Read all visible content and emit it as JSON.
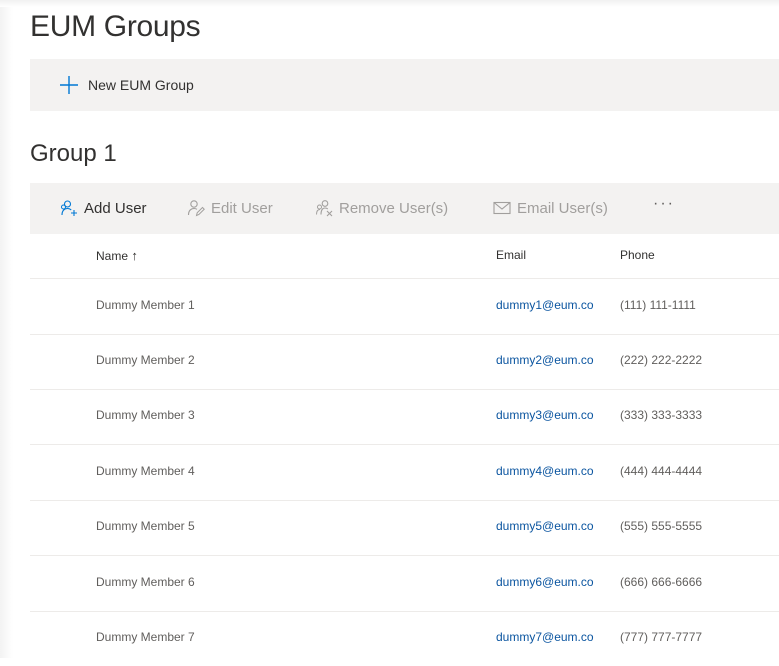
{
  "page": {
    "title": "EUM Groups"
  },
  "command_bar": {
    "new_group_label": "New EUM Group",
    "new_group_icon": "plus-icon"
  },
  "group": {
    "title": "Group 1"
  },
  "toolbar": {
    "add_user": {
      "label": "Add User",
      "icon": "add-friend-icon",
      "enabled": true
    },
    "edit_user": {
      "label": "Edit User",
      "icon": "edit-contact-icon",
      "enabled": false
    },
    "remove_users": {
      "label": "Remove User(s)",
      "icon": "remove-people-icon",
      "enabled": false
    },
    "email_users": {
      "label": "Email User(s)",
      "icon": "mail-icon",
      "enabled": false
    },
    "more": "···"
  },
  "table": {
    "columns": {
      "name": "Name",
      "name_sort_glyph": "↑",
      "email": "Email",
      "phone": "Phone"
    },
    "rows": [
      {
        "name": "Dummy Member 1",
        "email": "dummy1@eum.co",
        "phone": "(111) 111-1111"
      },
      {
        "name": "Dummy Member 2",
        "email": "dummy2@eum.co",
        "phone": "(222) 222-2222"
      },
      {
        "name": "Dummy Member 3",
        "email": "dummy3@eum.co",
        "phone": "(333) 333-3333"
      },
      {
        "name": "Dummy Member 4",
        "email": "dummy4@eum.co",
        "phone": "(444) 444-4444"
      },
      {
        "name": "Dummy Member 5",
        "email": "dummy5@eum.co",
        "phone": "(555) 555-5555"
      },
      {
        "name": "Dummy Member 6",
        "email": "dummy6@eum.co",
        "phone": "(666) 666-6666"
      },
      {
        "name": "Dummy Member 7",
        "email": "dummy7@eum.co",
        "phone": "(777) 777-7777"
      }
    ]
  },
  "colors": {
    "accent": "#0078d4",
    "link": "#0b55a0",
    "command_bar_bg": "#f3f2f1",
    "disabled_text": "#a19f9d"
  }
}
